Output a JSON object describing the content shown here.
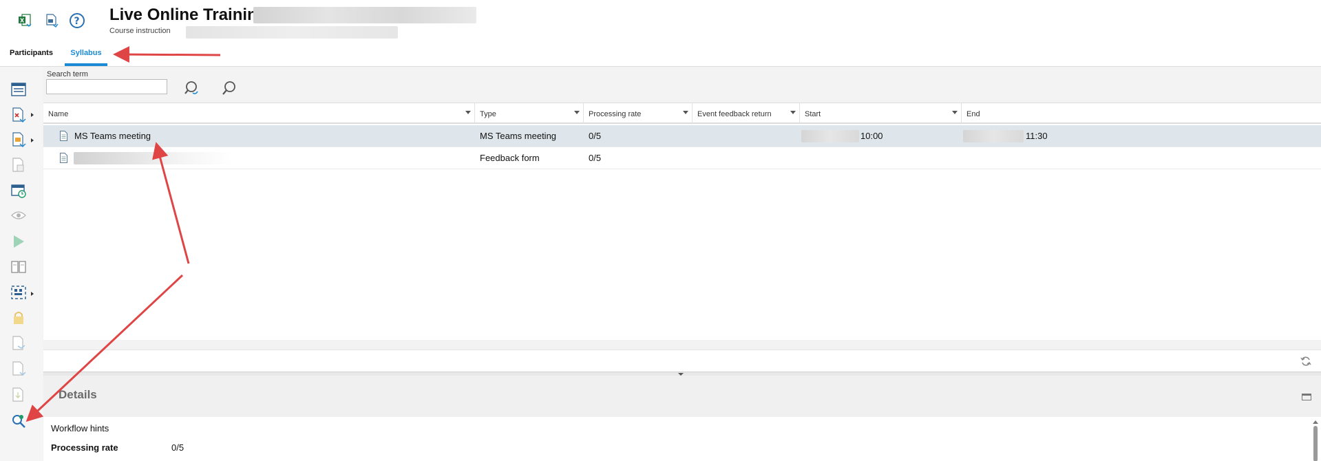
{
  "header": {
    "title": "Live Online Training",
    "subtitle": "Course instruction",
    "icons": [
      "excel-export-icon",
      "document-export-icon",
      "help-icon"
    ]
  },
  "tabs": [
    {
      "label": "Participants",
      "active": false
    },
    {
      "label": "Syllabus",
      "active": true
    }
  ],
  "toolbar": {
    "icons": [
      "list-view-icon",
      "delete-document-icon",
      "edit-document-icon",
      "calendar-document-icon",
      "schedule-icon",
      "preview-eye-icon",
      "play-icon",
      "book-icon",
      "qr-scan-icon",
      "lock-icon",
      "export-document-icon",
      "copy-document-icon",
      "download-document-icon",
      "search-zoom-icon"
    ]
  },
  "search": {
    "label": "Search term",
    "value": ""
  },
  "grid": {
    "columns": [
      "Name",
      "Type",
      "Processing rate",
      "Event feedback return",
      "Start",
      "End"
    ],
    "rows": [
      {
        "name": "MS Teams meeting",
        "type": "MS Teams meeting",
        "processing_rate": "0/5",
        "feedback_return": "",
        "start_time": "10:00",
        "end_time": "11:30",
        "selected": true
      },
      {
        "name": "",
        "type": "Feedback form",
        "processing_rate": "0/5",
        "feedback_return": "",
        "start_time": "",
        "end_time": "",
        "selected": false
      }
    ]
  },
  "details": {
    "title": "Details",
    "workflow_hints": "Workflow hints",
    "processing_rate_label": "Processing rate",
    "processing_rate_value": "0/5"
  },
  "colors": {
    "accent": "#1a8ad4",
    "annotation": "#e04545",
    "selected_row": "#dfe6eb"
  }
}
